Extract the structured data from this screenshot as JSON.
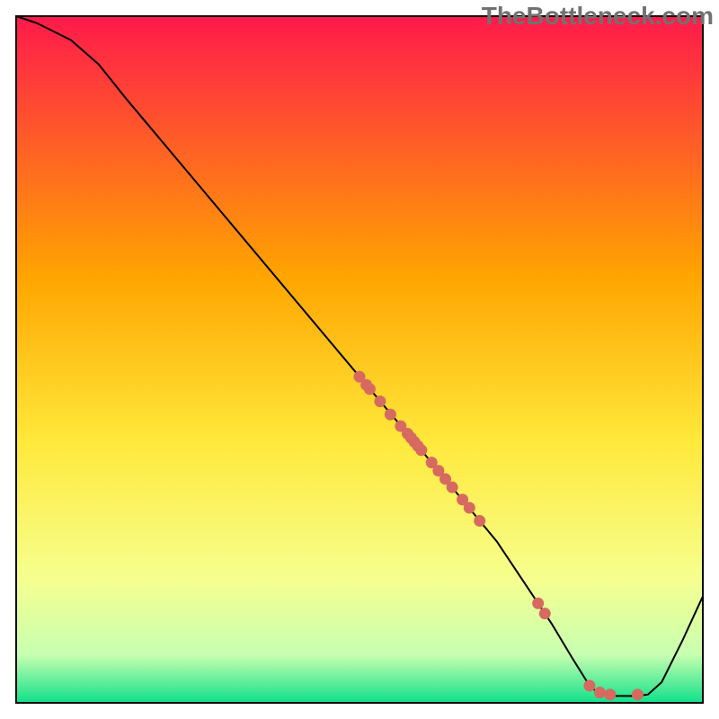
{
  "watermark": "TheBottleneck.com",
  "plot_margin": 18,
  "plot_size": 764,
  "chart_data": {
    "type": "line",
    "title": "",
    "xlabel": "",
    "ylabel": "",
    "xlim": [
      0,
      100
    ],
    "ylim": [
      0,
      100
    ],
    "axes_visible": false,
    "frame_visible": true,
    "gradient": {
      "top": "#ff1a4b",
      "upper_mid": "#ffa500",
      "mid": "#ffe93b",
      "lower_mid": "#f6ff8f",
      "near_bottom": "#c7ffb0",
      "bottom": "#10e08a"
    },
    "curve": [
      {
        "x": 0,
        "y": 100
      },
      {
        "x": 3,
        "y": 99
      },
      {
        "x": 8,
        "y": 96.5
      },
      {
        "x": 12,
        "y": 93
      },
      {
        "x": 16,
        "y": 88
      },
      {
        "x": 50,
        "y": 47.5
      },
      {
        "x": 58,
        "y": 38
      },
      {
        "x": 70,
        "y": 23.5
      },
      {
        "x": 78,
        "y": 11.5
      },
      {
        "x": 81,
        "y": 6.5
      },
      {
        "x": 83.5,
        "y": 2.5
      },
      {
        "x": 85,
        "y": 1.2
      },
      {
        "x": 87,
        "y": 1.0
      },
      {
        "x": 90,
        "y": 1.0
      },
      {
        "x": 92,
        "y": 1.2
      },
      {
        "x": 94,
        "y": 3.0
      },
      {
        "x": 97,
        "y": 9.0
      },
      {
        "x": 100,
        "y": 15.5
      }
    ],
    "points": [
      {
        "x": 50,
        "y": 47.5
      },
      {
        "x": 51,
        "y": 46.3
      },
      {
        "x": 51.5,
        "y": 45.7
      },
      {
        "x": 53,
        "y": 43.9
      },
      {
        "x": 54.5,
        "y": 42
      },
      {
        "x": 56,
        "y": 40.3
      },
      {
        "x": 57,
        "y": 39.2
      },
      {
        "x": 57.5,
        "y": 38.6
      },
      {
        "x": 58,
        "y": 38.0
      },
      {
        "x": 58.5,
        "y": 37.4
      },
      {
        "x": 59,
        "y": 36.8
      },
      {
        "x": 60.5,
        "y": 35.0
      },
      {
        "x": 61.5,
        "y": 33.8
      },
      {
        "x": 62.5,
        "y": 32.6
      },
      {
        "x": 63.5,
        "y": 31.4
      },
      {
        "x": 65,
        "y": 29.6
      },
      {
        "x": 66,
        "y": 28.4
      },
      {
        "x": 67.5,
        "y": 26.5
      },
      {
        "x": 76,
        "y": 14.5
      },
      {
        "x": 77,
        "y": 13.0
      },
      {
        "x": 83.5,
        "y": 2.5
      },
      {
        "x": 85,
        "y": 1.5
      },
      {
        "x": 86.5,
        "y": 1.2
      },
      {
        "x": 90.5,
        "y": 1.2
      }
    ],
    "point_color": "#d76a60",
    "point_radius": 6.5,
    "line_color": "#000000",
    "line_width": 2
  }
}
